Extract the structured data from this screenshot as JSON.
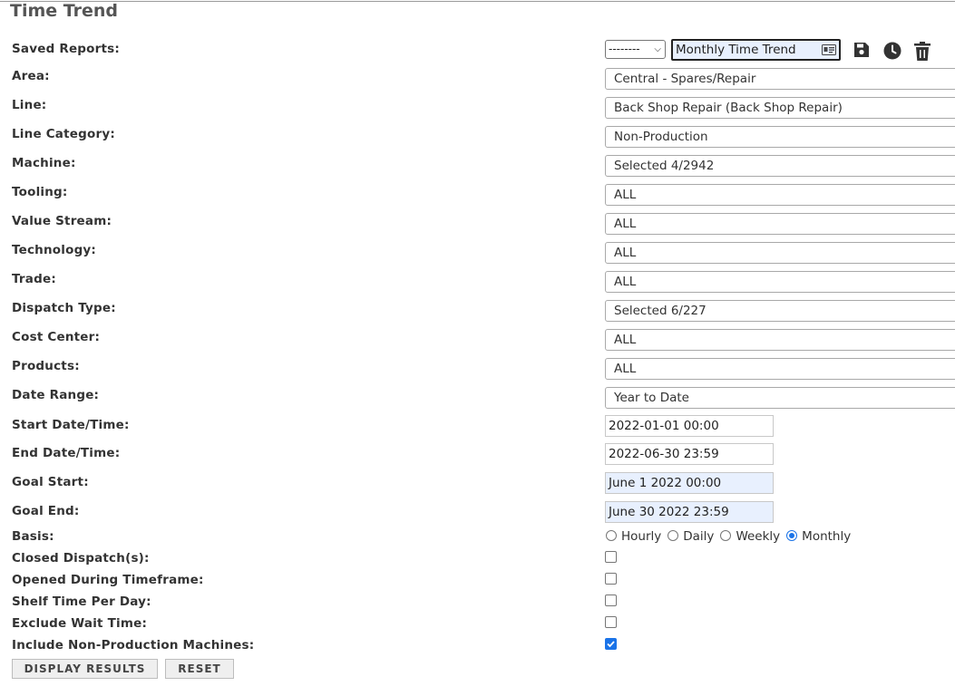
{
  "page": {
    "title": "Time Trend"
  },
  "saved_reports": {
    "label": "Saved Reports:",
    "dropdown_value": "--------",
    "name_value": "Monthly Time Trend"
  },
  "filters": [
    {
      "label": "Area:",
      "value": "Central - Spares/Repair"
    },
    {
      "label": "Line:",
      "value": "Back Shop Repair (Back Shop Repair)"
    },
    {
      "label": "Line Category:",
      "value": "Non-Production"
    },
    {
      "label": "Machine:",
      "value": "Selected 4/2942"
    },
    {
      "label": "Tooling:",
      "value": "ALL"
    },
    {
      "label": "Value Stream:",
      "value": "ALL"
    },
    {
      "label": "Technology:",
      "value": "ALL"
    },
    {
      "label": "Trade:",
      "value": "ALL"
    },
    {
      "label": "Dispatch Type:",
      "value": "Selected 6/227"
    },
    {
      "label": "Cost Center:",
      "value": "ALL"
    },
    {
      "label": "Products:",
      "value": "ALL"
    },
    {
      "label": "Date Range:",
      "value": "Year to Date"
    }
  ],
  "dates": {
    "start_label": "Start Date/Time:",
    "start_value": "2022-01-01 00:00",
    "end_label": "End Date/Time:",
    "end_value": "2022-06-30 23:59",
    "goal_start_label": "Goal Start:",
    "goal_start_value": "June 1 2022 00:00",
    "goal_end_label": "Goal End:",
    "goal_end_value": "June 30 2022 23:59"
  },
  "basis": {
    "label": "Basis:",
    "options": [
      "Hourly",
      "Daily",
      "Weekly",
      "Monthly"
    ],
    "selected": "Monthly"
  },
  "checkboxes": [
    {
      "label": "Closed Dispatch(s):",
      "checked": false
    },
    {
      "label": "Opened During Timeframe:",
      "checked": false
    },
    {
      "label": "Shelf Time Per Day:",
      "checked": false
    },
    {
      "label": "Exclude Wait Time:",
      "checked": false
    },
    {
      "label": "Include Non-Production Machines:",
      "checked": true
    }
  ],
  "buttons": {
    "display": "DISPLAY RESULTS",
    "reset": "RESET"
  },
  "colors": {
    "accent": "#1a73e8",
    "highlight_bg": "#e8f0fe",
    "icon": "#333333"
  },
  "icons": [
    "contact-card-icon",
    "save-icon",
    "clock-icon",
    "trash-icon"
  ]
}
